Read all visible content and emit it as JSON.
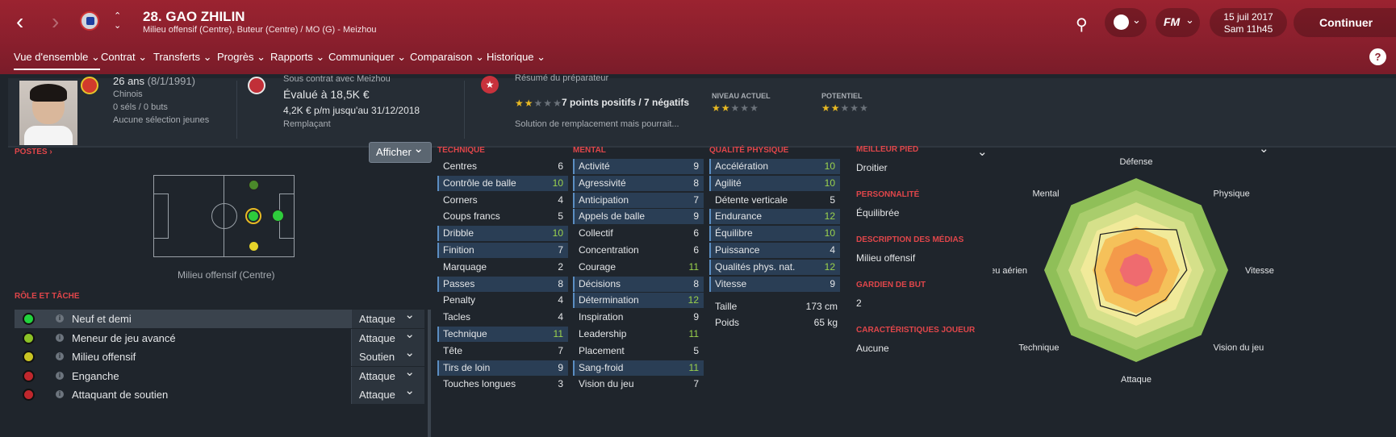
{
  "header": {
    "player_name": "28. GAO ZHILIN",
    "positions_line": "Milieu offensif (Centre), Buteur (Centre) / MO (G) - Meizhou",
    "date": "15 juil 2017",
    "time": "Sam 11h45",
    "continue_label": "Continuer",
    "back_icon": "chevron-left-icon",
    "forward_icon": "chevron-right-icon",
    "fm_label": "FM"
  },
  "menu": [
    "Vue d'ensemble",
    "Contrat",
    "Transferts",
    "Progrès",
    "Rapports",
    "Communiquer",
    "Comparaison",
    "Historique"
  ],
  "help_label": "?",
  "profile": {
    "age": "26 ans",
    "birth": "(8/1/1991)",
    "nationality": "Chinois",
    "selections": "0 séls / 0 buts",
    "youth": "Aucune sélection jeunes"
  },
  "contract": {
    "status": "Sous contrat avec Meizhou",
    "value": "Évalué à 18,5K €",
    "wage": "4,2K € p/m jusqu'au 31/12/2018",
    "role": "Remplaçant"
  },
  "coach_report": {
    "title": "Résumé du préparateur",
    "summary": "7 points positifs / 7 négatifs",
    "summary_stars": 2,
    "note": "Solution de remplacement mais pourrait...",
    "current_label": "NIVEAU ACTUEL",
    "current_stars": 2,
    "potential_label": "POTENTIEL",
    "potential_stars": 2
  },
  "positions": {
    "title": "POSTES ›",
    "display_button": "Afficher",
    "position_label": "Milieu offensif (Centre)"
  },
  "role_section": {
    "title": "RÔLE ET TÂCHE",
    "roles": [
      {
        "name": "Neuf et demi",
        "duty": "Attaque",
        "color": "#22d33c"
      },
      {
        "name": "Meneur de jeu avancé",
        "duty": "Attaque",
        "color": "#8cc226"
      },
      {
        "name": "Milieu offensif",
        "duty": "Soutien",
        "color": "#c9c423"
      },
      {
        "name": "Enganche",
        "duty": "Attaque",
        "color": "#c0272d"
      },
      {
        "name": "Attaquant de soutien",
        "duty": "Attaque",
        "color": "#c0272d"
      }
    ]
  },
  "technique": {
    "title": "TECHNIQUE",
    "attrs": [
      {
        "name": "Centres",
        "value": "6"
      },
      {
        "name": "Contrôle de balle",
        "value": "10"
      },
      {
        "name": "Corners",
        "value": "4"
      },
      {
        "name": "Coups francs",
        "value": "5"
      },
      {
        "name": "Dribble",
        "value": "10"
      },
      {
        "name": "Finition",
        "value": "7"
      },
      {
        "name": "Marquage",
        "value": "2"
      },
      {
        "name": "Passes",
        "value": "8"
      },
      {
        "name": "Penalty",
        "value": "4"
      },
      {
        "name": "Tacles",
        "value": "4"
      },
      {
        "name": "Technique",
        "value": "11"
      },
      {
        "name": "Tête",
        "value": "7"
      },
      {
        "name": "Tirs de loin",
        "value": "9"
      },
      {
        "name": "Touches longues",
        "value": "3"
      }
    ]
  },
  "mental": {
    "title": "MENTAL",
    "attrs": [
      {
        "name": "Activité",
        "value": "9"
      },
      {
        "name": "Agressivité",
        "value": "8"
      },
      {
        "name": "Anticipation",
        "value": "7"
      },
      {
        "name": "Appels de balle",
        "value": "9"
      },
      {
        "name": "Collectif",
        "value": "6"
      },
      {
        "name": "Concentration",
        "value": "6"
      },
      {
        "name": "Courage",
        "value": "11"
      },
      {
        "name": "Décisions",
        "value": "8"
      },
      {
        "name": "Détermination",
        "value": "12"
      },
      {
        "name": "Inspiration",
        "value": "9"
      },
      {
        "name": "Leadership",
        "value": "11"
      },
      {
        "name": "Placement",
        "value": "5"
      },
      {
        "name": "Sang-froid",
        "value": "11"
      },
      {
        "name": "Vision du jeu",
        "value": "7"
      }
    ]
  },
  "physical": {
    "title": "QUALITÉ PHYSIQUE",
    "attrs": [
      {
        "name": "Accélération",
        "value": "10"
      },
      {
        "name": "Agilité",
        "value": "10"
      },
      {
        "name": "Détente verticale",
        "value": "5"
      },
      {
        "name": "Endurance",
        "value": "12"
      },
      {
        "name": "Équilibre",
        "value": "10"
      },
      {
        "name": "Puissance",
        "value": "4"
      },
      {
        "name": "Qualités phys. nat.",
        "value": "12"
      },
      {
        "name": "Vitesse",
        "value": "9"
      }
    ],
    "height_label": "Taille",
    "height": "173 cm",
    "weight_label": "Poids",
    "weight": "65 kg"
  },
  "details": [
    {
      "title": "MEILLEUR PIED",
      "value": "Droitier"
    },
    {
      "title": "PERSONNALITÉ",
      "value": "Équilibrée"
    },
    {
      "title": "DESCRIPTION DES MÉDIAS",
      "value": "Milieu offensif"
    },
    {
      "title": "GARDIEN DE BUT",
      "value": "2"
    },
    {
      "title": "CARACTÉRISTIQUES JOUEUR",
      "value": "Aucune"
    }
  ],
  "radar": {
    "axes": [
      "Défense",
      "Physique",
      "Vitesse",
      "Vision du jeu",
      "Attaque",
      "Technique",
      "Jeu aérien",
      "Mental"
    ],
    "player_values": [
      0.45,
      0.62,
      0.55,
      0.45,
      0.5,
      0.55,
      0.45,
      0.55
    ],
    "ring_colors": [
      "#8fbf58",
      "#a9cd6c",
      "#d5e08a",
      "#f1ea9a",
      "#f5c15a",
      "#f49a4a",
      "#ef6b6f"
    ]
  }
}
